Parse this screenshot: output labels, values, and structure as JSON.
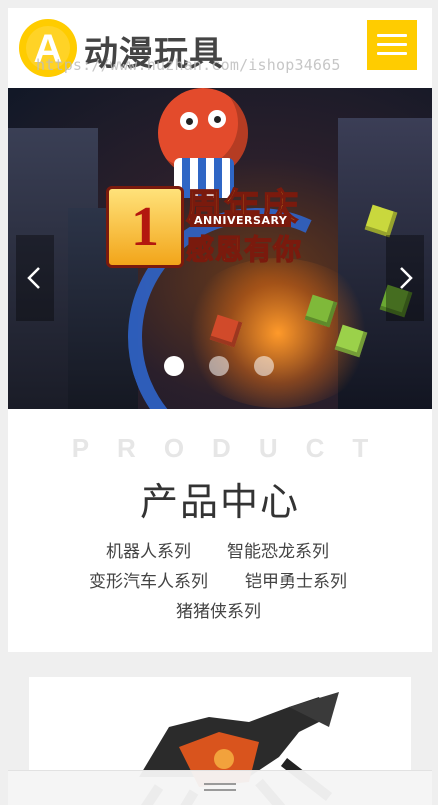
{
  "header": {
    "brand": "动漫玩具",
    "logo_letter": "A",
    "watermark_url": "https://www.huzhan.com/ishop34665",
    "menu_icon": "hamburger-menu-icon",
    "accent_color": "#ffcc00"
  },
  "banner": {
    "calendar_number": "1",
    "headline": "周年庆",
    "english": "ANNIVERSARY",
    "subline": "感恩有你",
    "prev_icon": "chevron-left-icon",
    "next_icon": "chevron-right-icon",
    "slide_count": 3,
    "active_slide": 1
  },
  "product": {
    "english_title": "PRODUCT",
    "title": "产品中心",
    "categories": [
      "机器人系列",
      "智能恐龙系列",
      "变形汽车人系列",
      "铠甲勇士系列",
      "猪猪侠系列"
    ]
  },
  "bottom_bar": {
    "handle_icon": "drag-handle-icon"
  }
}
